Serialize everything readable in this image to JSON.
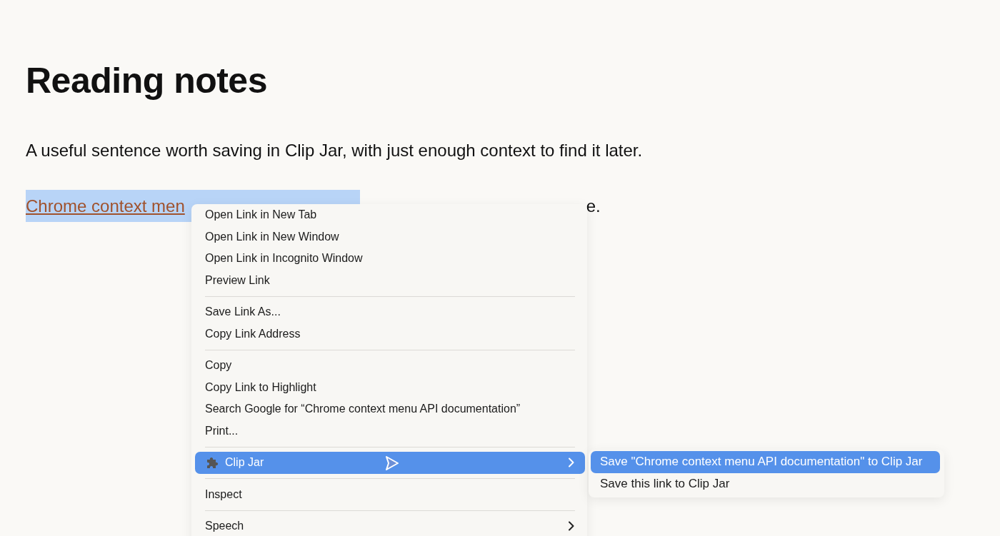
{
  "page": {
    "title": "Reading notes",
    "paragraph": "A useful sentence worth saving in Clip Jar, with just enough context to find it later.",
    "link_line": {
      "link": "Chrome context men",
      "selected": true,
      "tail": "e."
    }
  },
  "context_menu": {
    "items": [
      {
        "kind": "item",
        "label": "Open Link in New Tab",
        "selected": false
      },
      {
        "kind": "item",
        "label": "Open Link in New Window",
        "selected": false
      },
      {
        "kind": "item",
        "label": "Open Link in Incognito Window",
        "selected": false
      },
      {
        "kind": "item",
        "label": "Preview Link",
        "selected": false
      },
      {
        "kind": "separator"
      },
      {
        "kind": "item",
        "label": "Save Link As...",
        "selected": false
      },
      {
        "kind": "item",
        "label": "Copy Link Address",
        "selected": false
      },
      {
        "kind": "separator"
      },
      {
        "kind": "item",
        "label": "Copy",
        "selected": false
      },
      {
        "kind": "item",
        "label": "Copy Link to Highlight",
        "selected": false
      },
      {
        "kind": "item",
        "label": "Search Google for “Chrome context menu API documentation”",
        "selected": false
      },
      {
        "kind": "item",
        "label": "Print...",
        "selected": false
      },
      {
        "kind": "separator"
      },
      {
        "kind": "extension",
        "label": "Clip Jar",
        "selected": true
      },
      {
        "kind": "separator"
      },
      {
        "kind": "item",
        "label": "Inspect",
        "selected": false
      },
      {
        "kind": "separator"
      },
      {
        "kind": "submenu",
        "label": "Speech",
        "selected": false
      }
    ]
  },
  "submenu": {
    "items": [
      {
        "label": "Save \"Chrome context menu API documentation\" to Clip Jar",
        "selected": true
      },
      {
        "label": "Save this link to Clip Jar",
        "selected": false
      }
    ]
  }
}
